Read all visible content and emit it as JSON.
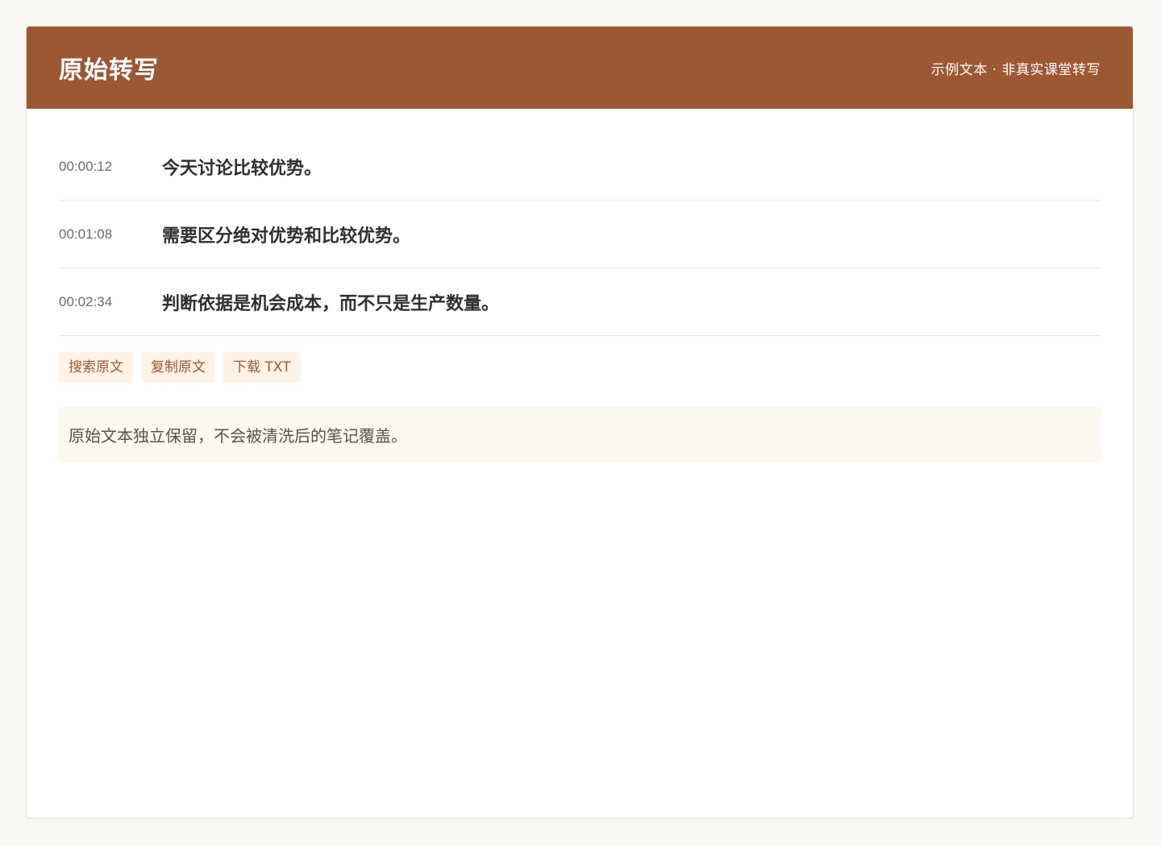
{
  "header": {
    "title": "原始转写",
    "subtitle": "示例文本 · 非真实课堂转写"
  },
  "transcript": [
    {
      "time": "00:00:12",
      "text": "今天讨论比较优势。"
    },
    {
      "time": "00:01:08",
      "text": "需要区分绝对优势和比较优势。"
    },
    {
      "time": "00:02:34",
      "text": "判断依据是机会成本，而不只是生产数量。"
    }
  ],
  "actions": {
    "search": "搜索原文",
    "copy": "复制原文",
    "download": "下载 TXT"
  },
  "note": "原始文本独立保留，不会被清洗后的笔记覆盖。",
  "colors": {
    "accent": "#9c5832",
    "button_bg": "#fdf3e6",
    "note_bg": "#fdf8ef"
  }
}
